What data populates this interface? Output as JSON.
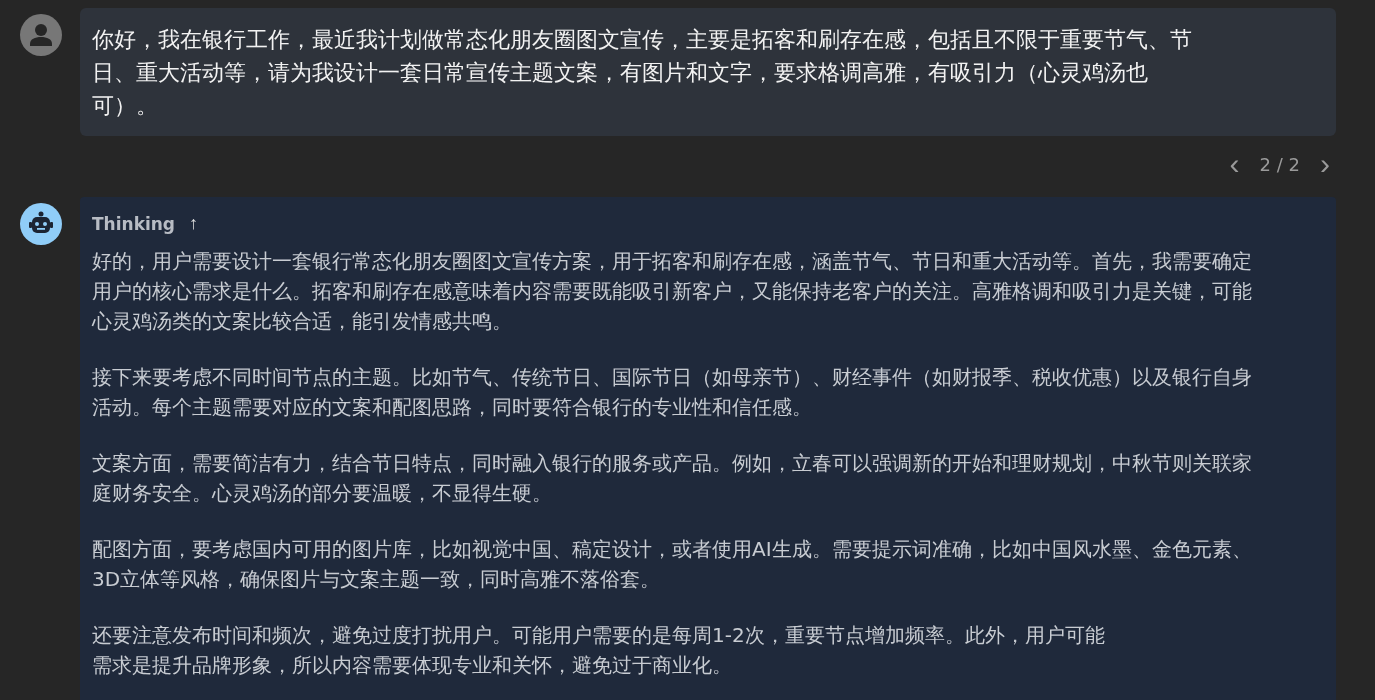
{
  "messages": [
    {
      "kind": "user",
      "lines": [
        "你好，我在银行工作，最近我计划做常态化朋友圈图文宣传，主要是拓客和刷存在感，包括且不限于重要节气、节",
        "日、重大活动等，请为我设计一套日常宣传主题文案，有图片和文字，要求格调高雅，有吸引力（心灵鸡汤也",
        "可）。"
      ],
      "pager": {
        "prev": "‹",
        "label": "2 / 2",
        "next": "›"
      }
    },
    {
      "kind": "assistant",
      "thinking": {
        "label": "Thinking",
        "toggle": "↑",
        "expanded": true,
        "paragraphs": [
          [
            "好的，用户需要设计一套银行常态化朋友圈图文宣传方案，用于拓客和刷存在感，涵盖节气、节日和重大活动等。首先，我需要确定",
            "用户的核心需求是什么。拓客和刷存在感意味着内容需要既能吸引新客户，又能保持老客户的关注。高雅格调和吸引力是关键，可能",
            "心灵鸡汤类的文案比较合适，能引发情感共鸣。"
          ],
          [
            "接下来要考虑不同时间节点的主题。比如节气、传统节日、国际节日（如母亲节）、财经事件（如财报季、税收优惠）以及银行自身",
            "活动。每个主题需要对应的文案和配图思路，同时要符合银行的专业性和信任感。"
          ],
          [
            "文案方面，需要简洁有力，结合节日特点，同时融入银行的服务或产品。例如，立春可以强调新的开始和理财规划，中秋节则关联家",
            "庭财务安全。心灵鸡汤的部分要温暖，不显得生硬。"
          ],
          [
            "配图方面，要考虑国内可用的图片库，比如视觉中国、稿定设计，或者使用AI生成。需要提示词准确，比如中国风水墨、金色元素、",
            "3D立体等风格，确保图片与文案主题一致，同时高雅不落俗套。"
          ],
          [
            "还要注意发布时间和频次，避免过度打扰用户。可能用户需要的是每周1-2次，重要节点增加频率。此外，用户可能",
            "需求是提升品牌形象，所以内容需要体现专业和关怀，避免过于商业化。"
          ]
        ]
      }
    }
  ]
}
